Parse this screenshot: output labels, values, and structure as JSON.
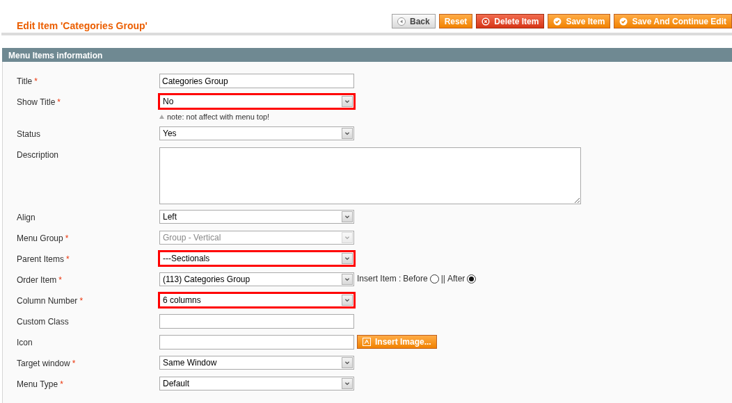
{
  "page_title": "Edit Item 'Categories Group'",
  "buttons": [
    {
      "label": "Back",
      "kind": "back"
    },
    {
      "label": "Reset",
      "kind": "plain"
    },
    {
      "label": "Delete Item",
      "kind": "delete"
    },
    {
      "label": "Save Item",
      "kind": "save"
    },
    {
      "label": "Save And Continue Edit",
      "kind": "save"
    }
  ],
  "section": {
    "title": "Menu Items information"
  },
  "fields": [
    {
      "label": "Title",
      "required_mark": "*",
      "kind": "text",
      "value": "Categories Group"
    },
    {
      "label": "Show Title",
      "required_mark": "*",
      "kind": "select",
      "value": "No",
      "highlighted": true,
      "note": "note: not affect with menu top!"
    },
    {
      "label": "Status",
      "kind": "select",
      "value": "Yes",
      "highlighted": false
    },
    {
      "label": "Description",
      "kind": "textarea"
    },
    {
      "label": "Align",
      "kind": "select",
      "value": "Left",
      "highlighted": false
    },
    {
      "label": "Menu Group",
      "required_mark": "*",
      "kind": "select",
      "value": "Group - Vertical",
      "highlighted": false,
      "disabled": true
    },
    {
      "label": "Parent Items",
      "required_mark": "*",
      "kind": "select",
      "value": "---Sectionals",
      "highlighted": true
    },
    {
      "label": "Order Item",
      "required_mark": "*",
      "kind": "select",
      "value": "(113) Categories Group",
      "highlighted": false,
      "insert": {
        "label": "Insert Item :",
        "options": [
          {
            "label": "Before",
            "selected": false
          },
          {
            "label": "After",
            "selected": true
          }
        ],
        "separator": "||"
      }
    },
    {
      "label": "Column Number",
      "required_mark": "*",
      "kind": "select",
      "value": "6 columns",
      "highlighted": true
    },
    {
      "label": "Custom Class",
      "kind": "text"
    },
    {
      "label": "Icon",
      "kind": "text",
      "button": "Insert Image..."
    },
    {
      "label": "Target window",
      "required_mark": "*",
      "kind": "select",
      "value": "Same Window",
      "highlighted": false
    },
    {
      "label": "Menu Type",
      "required_mark": "*",
      "kind": "select",
      "value": "Default",
      "highlighted": false
    }
  ]
}
